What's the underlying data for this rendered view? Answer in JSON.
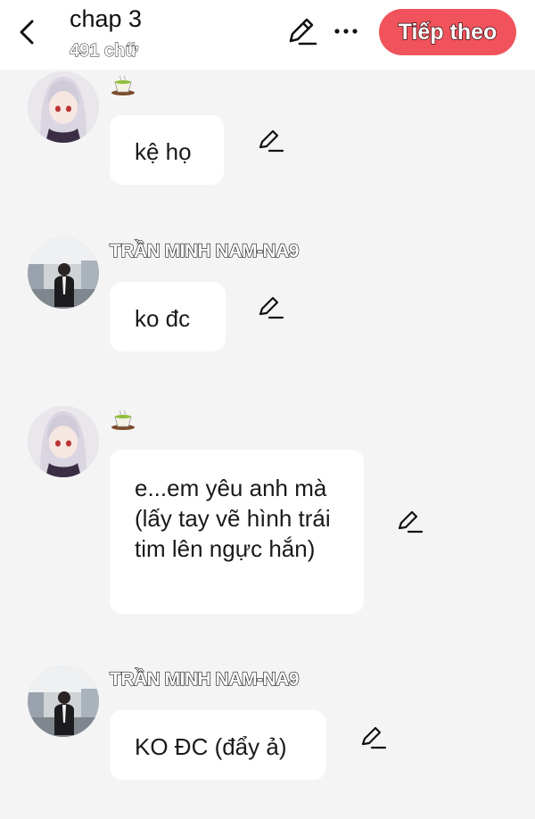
{
  "header": {
    "title": "chap 3",
    "word_count": "491 chữ",
    "next_label": "Tiếp theo",
    "icons": [
      "back-chevron-icon",
      "pencil-icon",
      "more-dots-icon"
    ],
    "accent_color": "#f0535c"
  },
  "messages": [
    {
      "sender": "",
      "sender_icon": "tea-cup-icon",
      "avatar": "anime-girl-avatar",
      "text": "kệ họ"
    },
    {
      "sender": "TRẦN MINH NAM-NA9",
      "avatar": "man-in-suit-avatar",
      "text": "ko đc"
    },
    {
      "sender": "",
      "sender_icon": "tea-cup-icon",
      "avatar": "anime-girl-avatar",
      "text": "e...em yêu anh mà (lấy tay vẽ hình trái tim lên ngực hắn)"
    },
    {
      "sender": "TRẦN MINH NAM-NA9",
      "avatar": "man-in-suit-avatar",
      "text": "KO ĐC (đẩy ả)"
    }
  ]
}
